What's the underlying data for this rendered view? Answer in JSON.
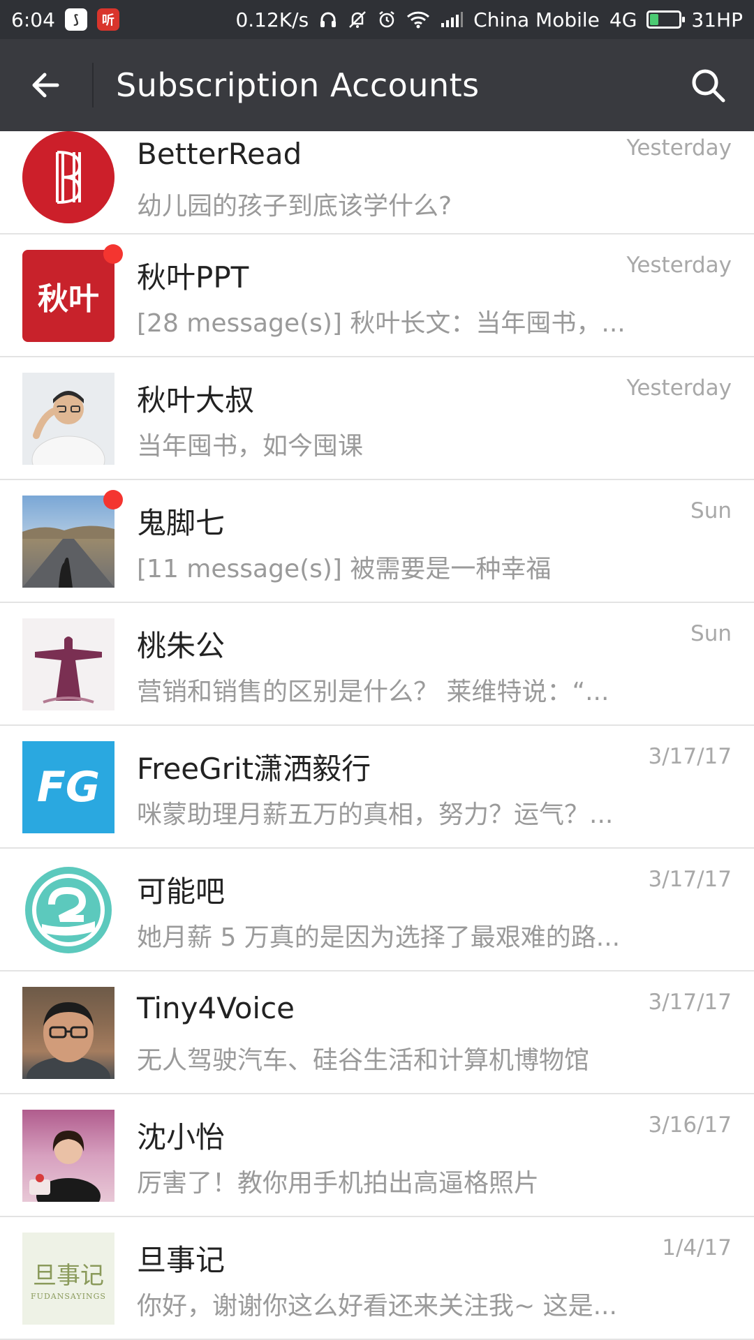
{
  "status_bar": {
    "time": "6:04",
    "app_icon_2_glyph": "听",
    "net_speed": "0.12K/s",
    "carrier": "China Mobile",
    "network": "4G",
    "battery_label": "31HP"
  },
  "header": {
    "title": "Subscription Accounts"
  },
  "accounts": [
    {
      "name": "BetterRead",
      "time": "Yesterday",
      "preview": "幼儿园的孩子到底该学什么?",
      "unread_dot": false,
      "avatar_icon": "betterread-logo"
    },
    {
      "name": "秋叶PPT",
      "time": "Yesterday",
      "preview": "[28 message(s)] 秋叶长文：当年囤书，...",
      "unread_dot": true,
      "avatar_icon": "qiuye-logo",
      "avatar_text": "秋叶"
    },
    {
      "name": "秋叶大叔",
      "time": "Yesterday",
      "preview": "当年囤书，如今囤课",
      "unread_dot": false,
      "avatar_icon": "person-photo"
    },
    {
      "name": "鬼脚七",
      "time": "Sun",
      "preview": "[11 message(s)] 被需要是一种幸福",
      "unread_dot": true,
      "avatar_icon": "road-photo"
    },
    {
      "name": "桃朱公",
      "time": "Sun",
      "preview": "营销和销售的区别是什么？ 莱维特说：“...",
      "unread_dot": false,
      "avatar_icon": "statue-painting"
    },
    {
      "name": "FreeGrit潇洒毅行",
      "time": "3/17/17",
      "preview": "咪蒙助理月薪五万的真相，努力？运气？...",
      "unread_dot": false,
      "avatar_icon": "fg-logo",
      "avatar_text": "FG"
    },
    {
      "name": "可能吧",
      "time": "3/17/17",
      "preview": "她月薪 5 万真的是因为选择了最艰难的路...",
      "unread_dot": false,
      "avatar_icon": "keneng-logo"
    },
    {
      "name": "Tiny4Voice",
      "time": "3/17/17",
      "preview": "无人驾驶汽车、硅谷生活和计算机博物馆",
      "unread_dot": false,
      "avatar_icon": "man-glasses-photo"
    },
    {
      "name": "沈小怡",
      "time": "3/16/17",
      "preview": "厉害了！教你用手机拍出高逼格照片",
      "unread_dot": false,
      "avatar_icon": "woman-photo"
    },
    {
      "name": "旦事记",
      "time": "1/4/17",
      "preview": "你好，谢谢你这么好看还来关注我~ 这是...",
      "unread_dot": false,
      "avatar_icon": "danshi-logo",
      "avatar_text": "旦事记",
      "avatar_subtext": "FUDANSAYINGS"
    }
  ],
  "colors": {
    "status_bar_bg": "#2f3136",
    "app_bar_bg": "#393a3f",
    "unread_dot": "#f43530",
    "divider": "#e3e3e3"
  }
}
